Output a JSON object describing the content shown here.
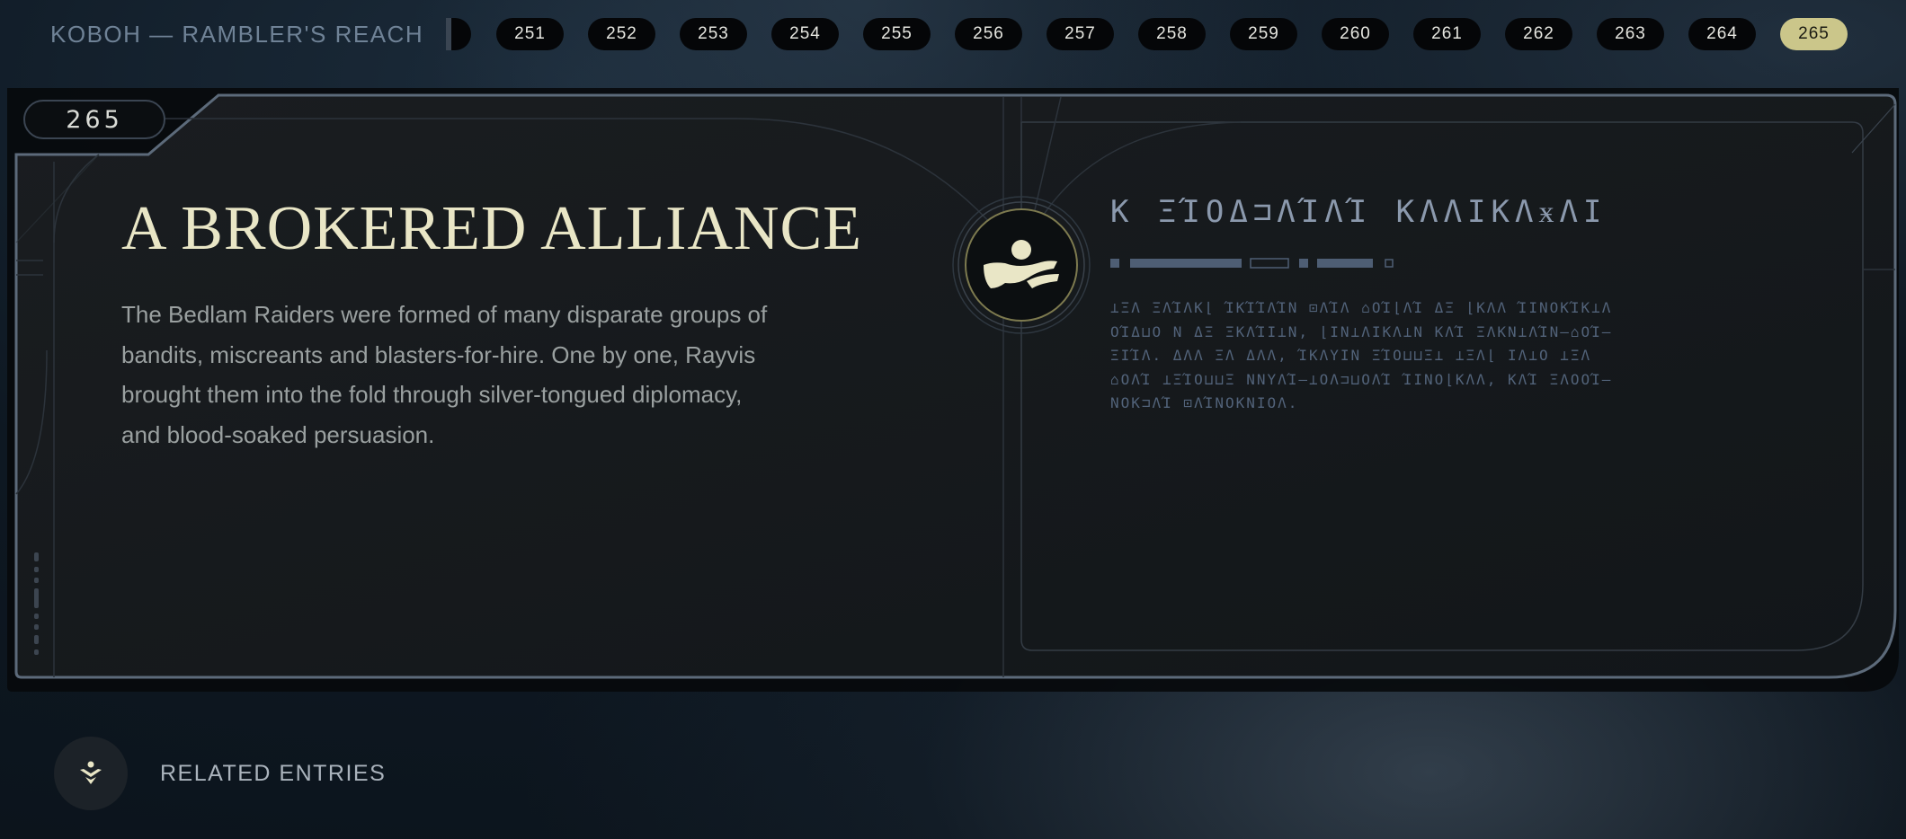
{
  "header": {
    "region_title": "KOBOH — RAMBLER'S REACH",
    "pages": [
      {
        "label": "251",
        "active": false
      },
      {
        "label": "252",
        "active": false
      },
      {
        "label": "253",
        "active": false
      },
      {
        "label": "254",
        "active": false
      },
      {
        "label": "255",
        "active": false
      },
      {
        "label": "256",
        "active": false
      },
      {
        "label": "257",
        "active": false
      },
      {
        "label": "258",
        "active": false
      },
      {
        "label": "259",
        "active": false
      },
      {
        "label": "260",
        "active": false
      },
      {
        "label": "261",
        "active": false
      },
      {
        "label": "262",
        "active": false
      },
      {
        "label": "263",
        "active": false
      },
      {
        "label": "264",
        "active": false
      },
      {
        "label": "265",
        "active": true
      }
    ]
  },
  "entry": {
    "number": "265",
    "title": "A BROKERED ALLIANCE",
    "body": "The Bedlam Raiders were formed of many disparate groups of bandits, miscreants and blasters-for-hire. One by one, Rayvis brought them into the fold through silver-tongued diplomacy, and blood-soaked persuasion.",
    "emblem_icon": "bedlam-raiders-emblem-icon",
    "aurebesh_title": "K ΞΊΟΔ⊐ΛΊΛΊ ΚΛΛΙΚΛӿΛΙ",
    "aurebesh_lines": [
      "⊥ΞΛ ΞΛΊΛΚ⌊ ΊΚΊΊΛΊΝ ⊡ΛΊΛ ⌂ΟΊ⌊ΛΊ ΔΞ ⌊ΚΛΛ ΊΙΝΟΚΊΚ⊥Λ",
      "ΟΊΔ⊔Ο Ν ΔΞ ΞΚΛΊΙ⊥Ν, ⌊ΙΝ⊥ΛΙΚΛ⊥Ν ΚΛΊ ΞΛΚΝ⊥ΛΊΝ–⌂ΟΊ–",
      "ΞΙΊΛ. ΔΛΛ ΞΛ ΔΛΛ, ΊΚΛΥΙΝ ΞΊΟ⊔⊔Ξ⊥ ⊥ΞΛ⌊ ΙΛ⊥Ο ⊥ΞΛ",
      "⌂ΟΛΊ ⊥ΞΊΟ⊔⊔Ξ ΝΝΥΛΊ–⊥ΟΛ⊐⊔ΟΛΊ ΊΙΝΟ⌊ΚΛΛ, ΚΛΊ ΞΛΟΟΊ–",
      "ΝΟΚ⊐ΛΊ ⊡ΛΊΝΟΚΝΙΟΛ."
    ]
  },
  "related": {
    "label": "RELATED ENTRIES",
    "icon": "related-entries-icon"
  }
}
